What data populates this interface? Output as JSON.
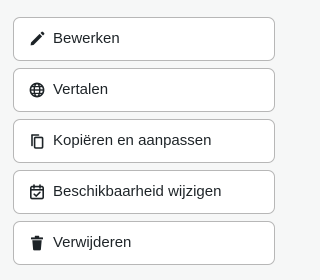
{
  "actions": [
    {
      "label": "Bewerken",
      "icon": "pencil-icon"
    },
    {
      "label": "Vertalen",
      "icon": "globe-icon"
    },
    {
      "label": "Kopiëren en aanpassen",
      "icon": "copy-icon"
    },
    {
      "label": "Beschikbaarheid wijzigen",
      "icon": "calendar-check-icon"
    },
    {
      "label": "Verwijderen",
      "icon": "trash-icon"
    }
  ],
  "colors": {
    "background": "#f6f7f7",
    "button_background": "#ffffff",
    "button_border": "#b7b7b7",
    "text": "#1d2327"
  }
}
